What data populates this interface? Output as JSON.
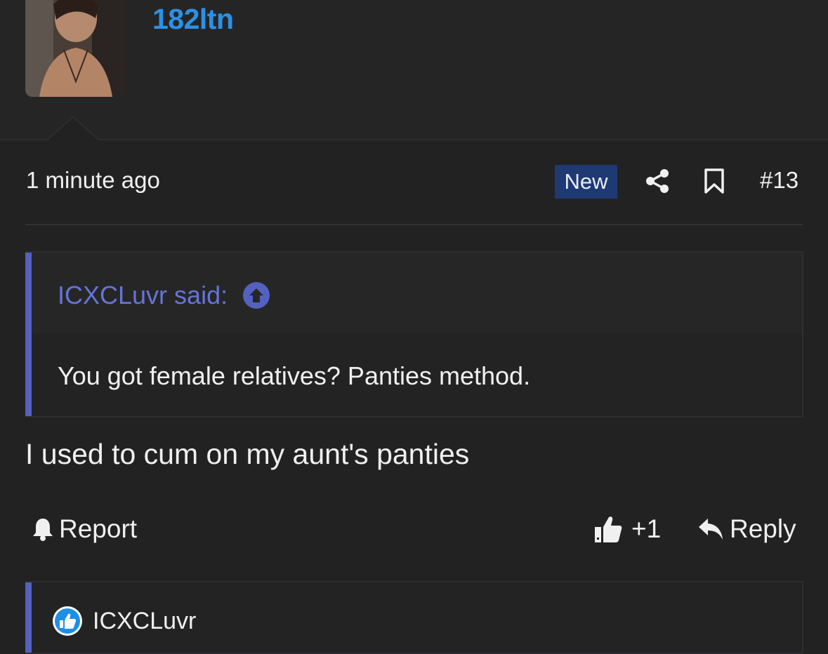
{
  "author": {
    "username": "182ltn"
  },
  "post": {
    "time": "1 minute ago",
    "badge": "New",
    "number": "#13",
    "message": "I used to cum on my aunt's panties"
  },
  "quote": {
    "attribution": "ICXCLuvr said:",
    "text": "You got female relatives? Panties method."
  },
  "actions": {
    "report": "Report",
    "like_count": "+1",
    "reply": "Reply"
  },
  "reactions": {
    "users": "ICXCLuvr"
  },
  "colors": {
    "username": "#2b91e8",
    "quote_accent": "#5361c0",
    "new_badge": "#1f3a73",
    "like_icon": "#1e8fe6"
  },
  "icons": [
    "share-icon",
    "bookmark-icon",
    "arrow-up-circle-icon",
    "bell-icon",
    "thumbs-up-icon",
    "reply-icon",
    "like-reaction-icon"
  ]
}
